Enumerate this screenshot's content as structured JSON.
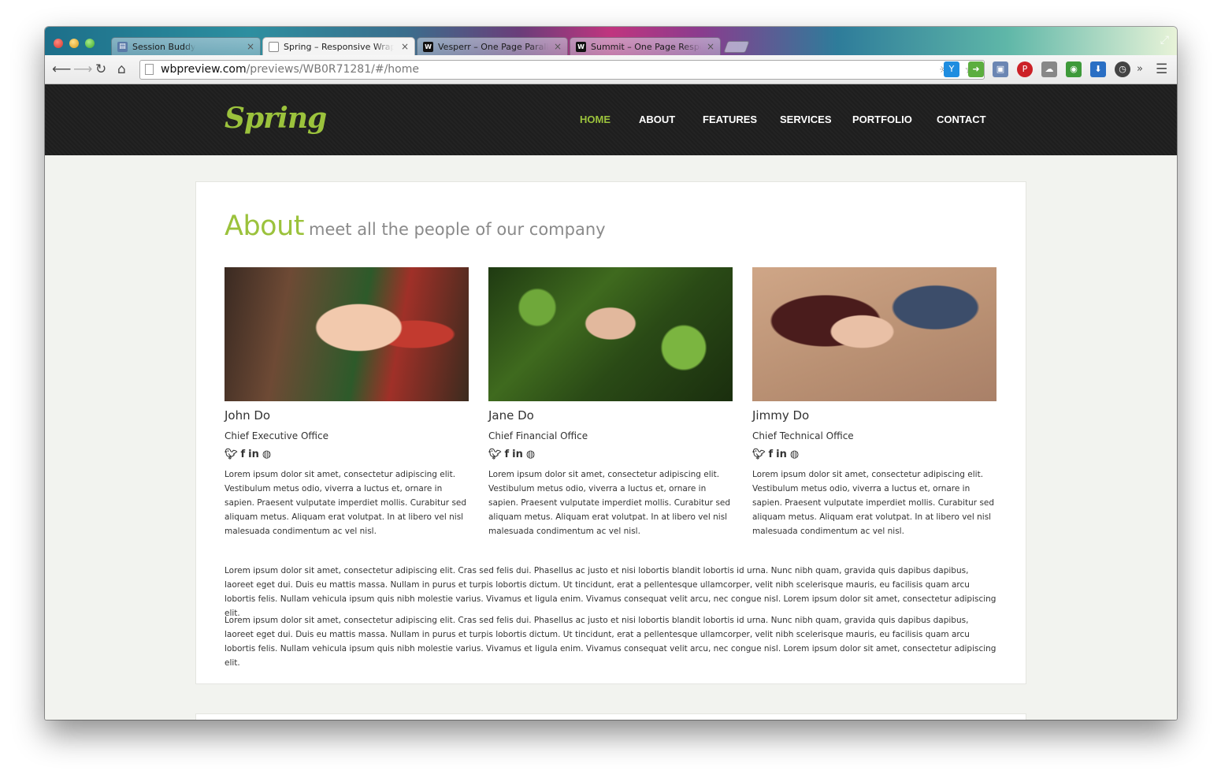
{
  "browser": {
    "tabs": [
      {
        "title": "Session Buddy",
        "favicon": "session-buddy-icon",
        "active": false
      },
      {
        "title": "Spring – Responsive Wrap",
        "favicon": "document-icon",
        "active": true
      },
      {
        "title": "Vesperr – One Page Paralla",
        "favicon": "wrapbootstrap-icon",
        "active": false
      },
      {
        "title": "Summit – One Page Respo",
        "favicon": "wrapbootstrap-icon",
        "active": false
      }
    ],
    "close_glyph": "×",
    "url_host": "wbpreview.com",
    "url_path": "/previews/WB0R71281/#/home"
  },
  "site": {
    "logo": "Spring",
    "brand_color": "#9bc23c",
    "nav": [
      "HOME",
      "ABOUT",
      "FEATURES",
      "SERVICES",
      "PORTFOLIO",
      "CONTACT"
    ],
    "active_nav": "HOME"
  },
  "about": {
    "title": "About",
    "subtitle": "meet all the people of our company",
    "members": [
      {
        "name": "John Do",
        "role": "Chief Executive Office",
        "bio": "Lorem ipsum dolor sit amet, consectetur adipiscing elit. Vestibulum metus odio, viverra a luctus et, ornare in sapien. Praesent vulputate imperdiet mollis. Curabitur sed aliquam metus. Aliquam erat volutpat. In at libero vel nisl malesuada condimentum ac vel nisl."
      },
      {
        "name": "Jane Do",
        "role": "Chief Financial Office",
        "bio": "Lorem ipsum dolor sit amet, consectetur adipiscing elit. Vestibulum metus odio, viverra a luctus et, ornare in sapien. Praesent vulputate imperdiet mollis. Curabitur sed aliquam metus. Aliquam erat volutpat. In at libero vel nisl malesuada condimentum ac vel nisl."
      },
      {
        "name": "Jimmy Do",
        "role": "Chief Technical Office",
        "bio": "Lorem ipsum dolor sit amet, consectetur adipiscing elit. Vestibulum metus odio, viverra a luctus et, ornare in sapien. Praesent vulputate imperdiet mollis. Curabitur sed aliquam metus. Aliquam erat volutpat. In at libero vel nisl malesuada condimentum ac vel nisl."
      }
    ],
    "social_icons": [
      "twitter-icon",
      "facebook-icon",
      "linkedin-icon",
      "github-icon"
    ],
    "paragraphs": [
      "Lorem ipsum dolor sit amet, consectetur adipiscing elit. Cras sed felis dui. Phasellus ac justo et nisi lobortis blandit lobortis id urna. Nunc nibh quam, gravida quis dapibus dapibus, laoreet eget dui. Duis eu mattis massa. Nullam in purus et turpis lobortis dictum. Ut tincidunt, erat a pellentesque ullamcorper, velit nibh scelerisque mauris, eu facilisis quam arcu lobortis felis. Nullam vehicula ipsum quis nibh molestie varius. Vivamus et ligula enim. Vivamus consequat velit arcu, nec congue nisl. Lorem ipsum dolor sit amet, consectetur adipiscing elit.",
      "Lorem ipsum dolor sit amet, consectetur adipiscing elit. Cras sed felis dui. Phasellus ac justo et nisi lobortis blandit lobortis id urna. Nunc nibh quam, gravida quis dapibus dapibus, laoreet eget dui. Duis eu mattis massa. Nullam in purus et turpis lobortis dictum. Ut tincidunt, erat a pellentesque ullamcorper, velit nibh scelerisque mauris, eu facilisis quam arcu lobortis felis. Nullam vehicula ipsum quis nibh molestie varius. Vivamus et ligula enim. Vivamus consequat velit arcu, nec congue nisl. Lorem ipsum dolor sit amet, consectetur adipiscing elit."
    ]
  }
}
